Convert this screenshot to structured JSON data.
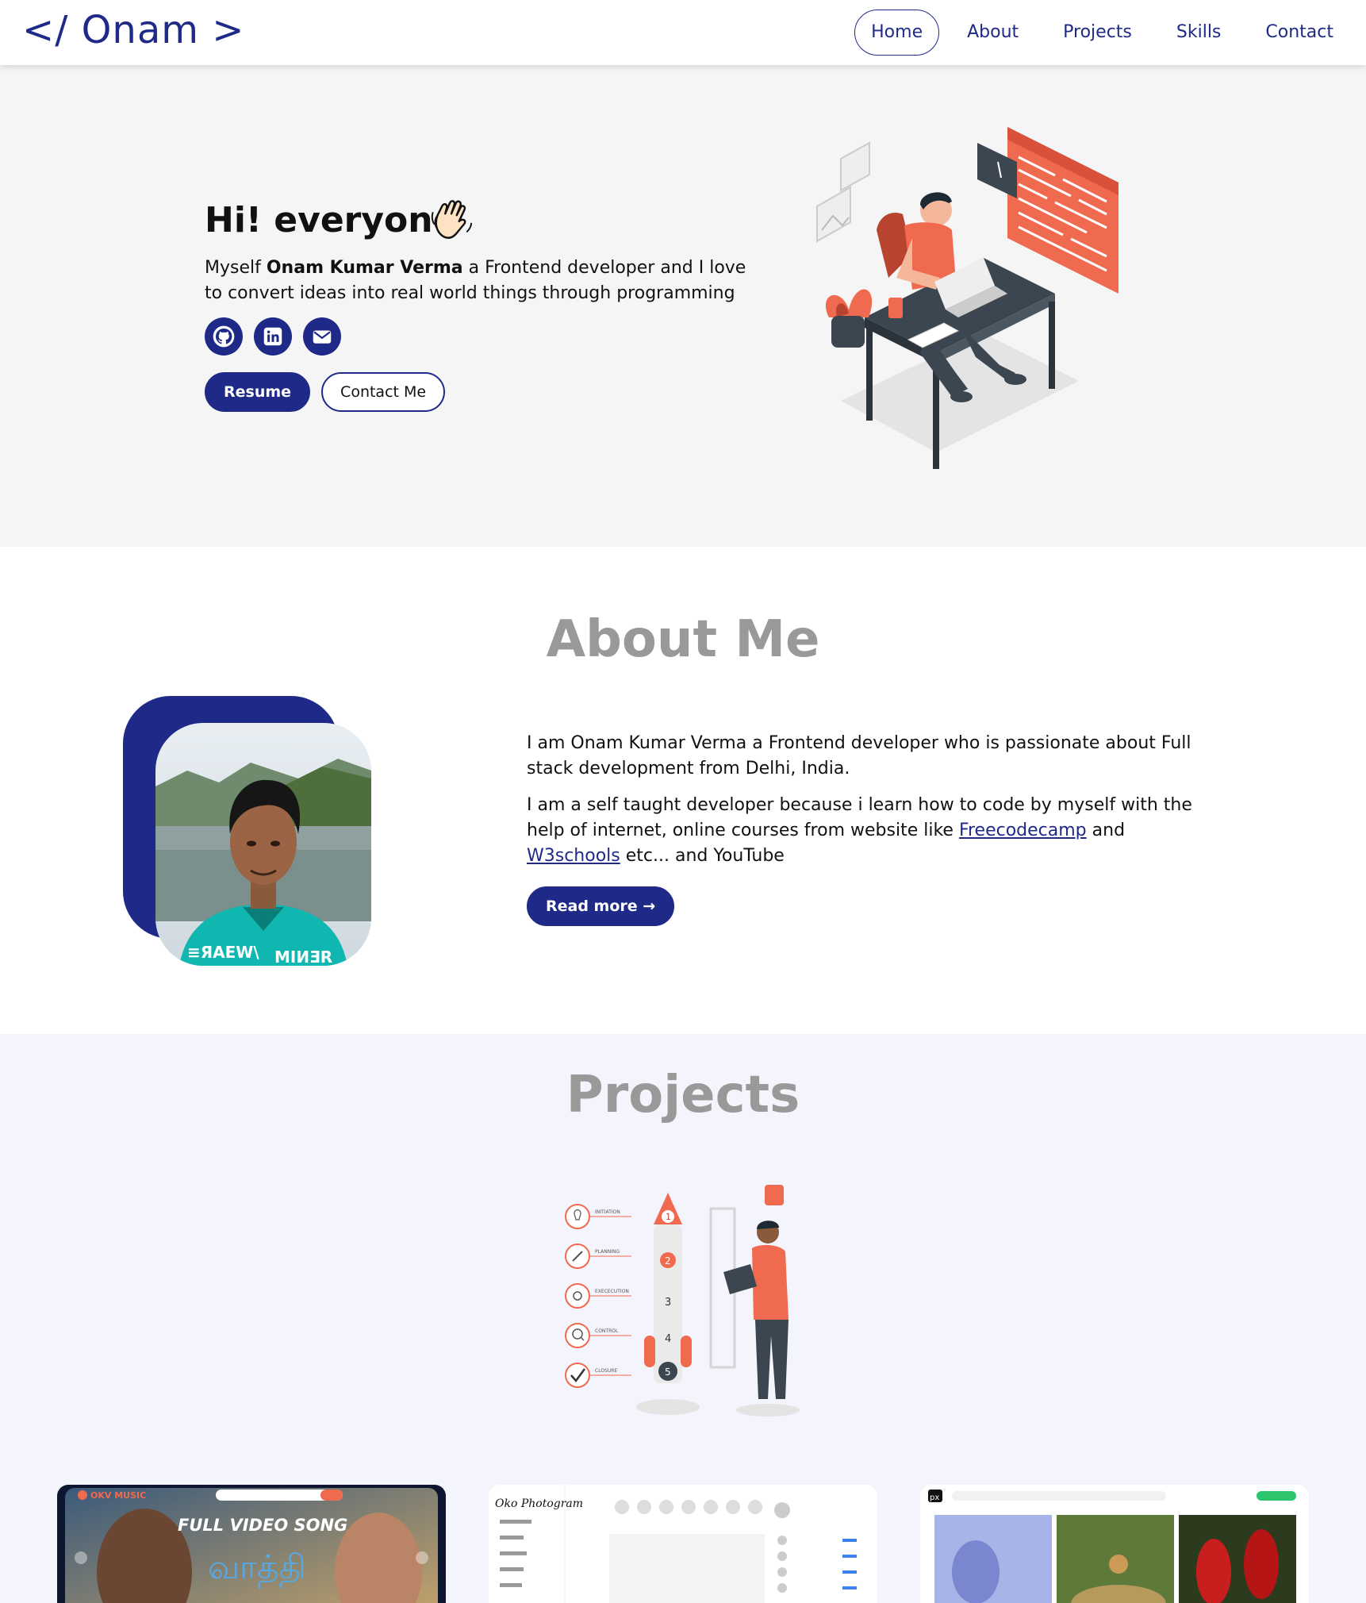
{
  "nav": {
    "logo": "</ Onam >",
    "links": [
      "Home",
      "About",
      "Projects",
      "Skills",
      "Contact"
    ]
  },
  "hero": {
    "title": "Hi! everyone",
    "desc_prefix": "Myself ",
    "desc_name": "Onam Kumar Verma",
    "desc_suffix": " a Frontend developer and I love to convert ideas into real world things through programming",
    "resume_label": "Resume",
    "contact_label": "Contact Me"
  },
  "about": {
    "title": "About Me",
    "p1": "I am Onam Kumar Verma a Frontend developer who is passionate about Full stack development from Delhi, India.",
    "p2_prefix": "I am a self taught developer because i learn how to code by myself with the help of internet, online courses from website like ",
    "link1": "Freecodecamp",
    "p2_mid": " and ",
    "link2": "W3schools",
    "p2_suffix": " etc... and YouTube",
    "readmore_label": "Read more →"
  },
  "projects": {
    "title": "Projects",
    "illus_steps": [
      "INITIATION",
      "PLANNING",
      "EXECECUTION",
      "CONTROL",
      "CLOSURE"
    ],
    "card1_text": "FULL VIDEO SONG",
    "card2_text": "Oko Photogram",
    "card3_text": "px"
  },
  "colors": {
    "primary": "#1f2a88",
    "accent": "#f06a50",
    "heading_gray": "#999999"
  }
}
